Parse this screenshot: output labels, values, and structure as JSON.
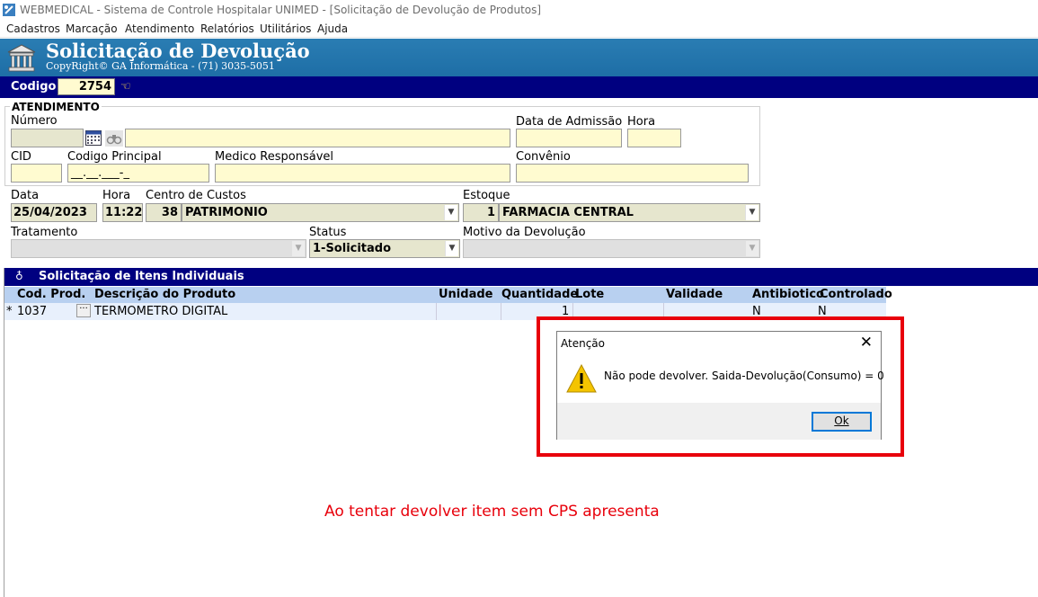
{
  "window": {
    "title": "WEBMEDICAL - Sistema de Controle Hospitalar UNIMED - [Solicitação de Devolução de Produtos]"
  },
  "menu": [
    "Cadastros",
    "Marcação",
    "Atendimento",
    "Relatórios",
    "Utilitários",
    "Ajuda"
  ],
  "header": {
    "title": "Solicitação de Devolução",
    "subtitle": "CopyRight© GA Informática - (71) 3035-5051"
  },
  "codigo": {
    "label": "Codigo",
    "value": "2754"
  },
  "atendimento": {
    "group_title": "ATENDIMENTO",
    "numero_label": "Número",
    "data_admissao_label": "Data de Admissão",
    "hora_label": "Hora",
    "cid_label": "CID",
    "codigo_principal_label": "Codigo Principal",
    "codigo_principal_mask": "__.__.___-_",
    "medico_label": "Medico Responsável",
    "convenio_label": "Convênio"
  },
  "form": {
    "data_label": "Data",
    "data_value": "25/04/2023",
    "hora_label": "Hora",
    "hora_value": "11:22",
    "centro_label": "Centro de Custos",
    "centro_code": "38",
    "centro_name": "PATRIMONIO",
    "estoque_label": "Estoque",
    "estoque_code": "1",
    "estoque_name": "FARMACIA CENTRAL",
    "tratamento_label": "Tratamento",
    "status_label": "Status",
    "status_value": "1-Solicitado",
    "motivo_label": "Motivo da Devolução"
  },
  "items": {
    "section_title": "Solicitação de Itens Individuais",
    "columns": [
      "Cod. Prod.",
      "Descrição do Produto",
      "Unidade",
      "Quantidade",
      "Lote",
      "Validade",
      "Antibiotico",
      "Controlado"
    ],
    "rows": [
      {
        "marker": "*",
        "cod": "1037",
        "descricao": "TERMOMETRO DIGITAL",
        "unidade": "",
        "quantidade": "1",
        "lote": "",
        "validade": "",
        "antibiotico": "N",
        "controlado": "N"
      }
    ]
  },
  "dialog": {
    "title": "Atenção",
    "message": "Não pode devolver. Saida-Devolução(Consumo) = 0",
    "ok_label": "Ok"
  },
  "annotation": "Ao tentar devolver item sem CPS apresenta e",
  "colors": {
    "header_blue": "#1e6ea6",
    "navy": "#000080",
    "input_yellow": "#fffbd0",
    "highlight": "#e8000b"
  }
}
